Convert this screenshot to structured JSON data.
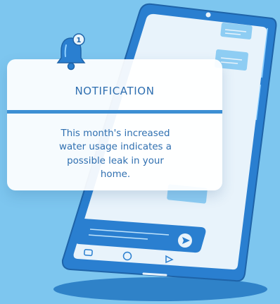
{
  "notification": {
    "title": "NOTIFICATION",
    "message": "This month's increased water usage indicates a possible leak in your home.",
    "badge_count": "1"
  },
  "colors": {
    "background": "#7dc6ef",
    "phone_body": "#2a7fd0",
    "accent_blue": "#3d8fd3",
    "text": "#2f6fb0",
    "card": "#ffffff"
  },
  "icons": {
    "bell": "bell-icon",
    "send": "send-icon",
    "nav_back": "nav-back-icon",
    "nav_home": "nav-home-icon",
    "nav_recent": "nav-recent-icon"
  }
}
